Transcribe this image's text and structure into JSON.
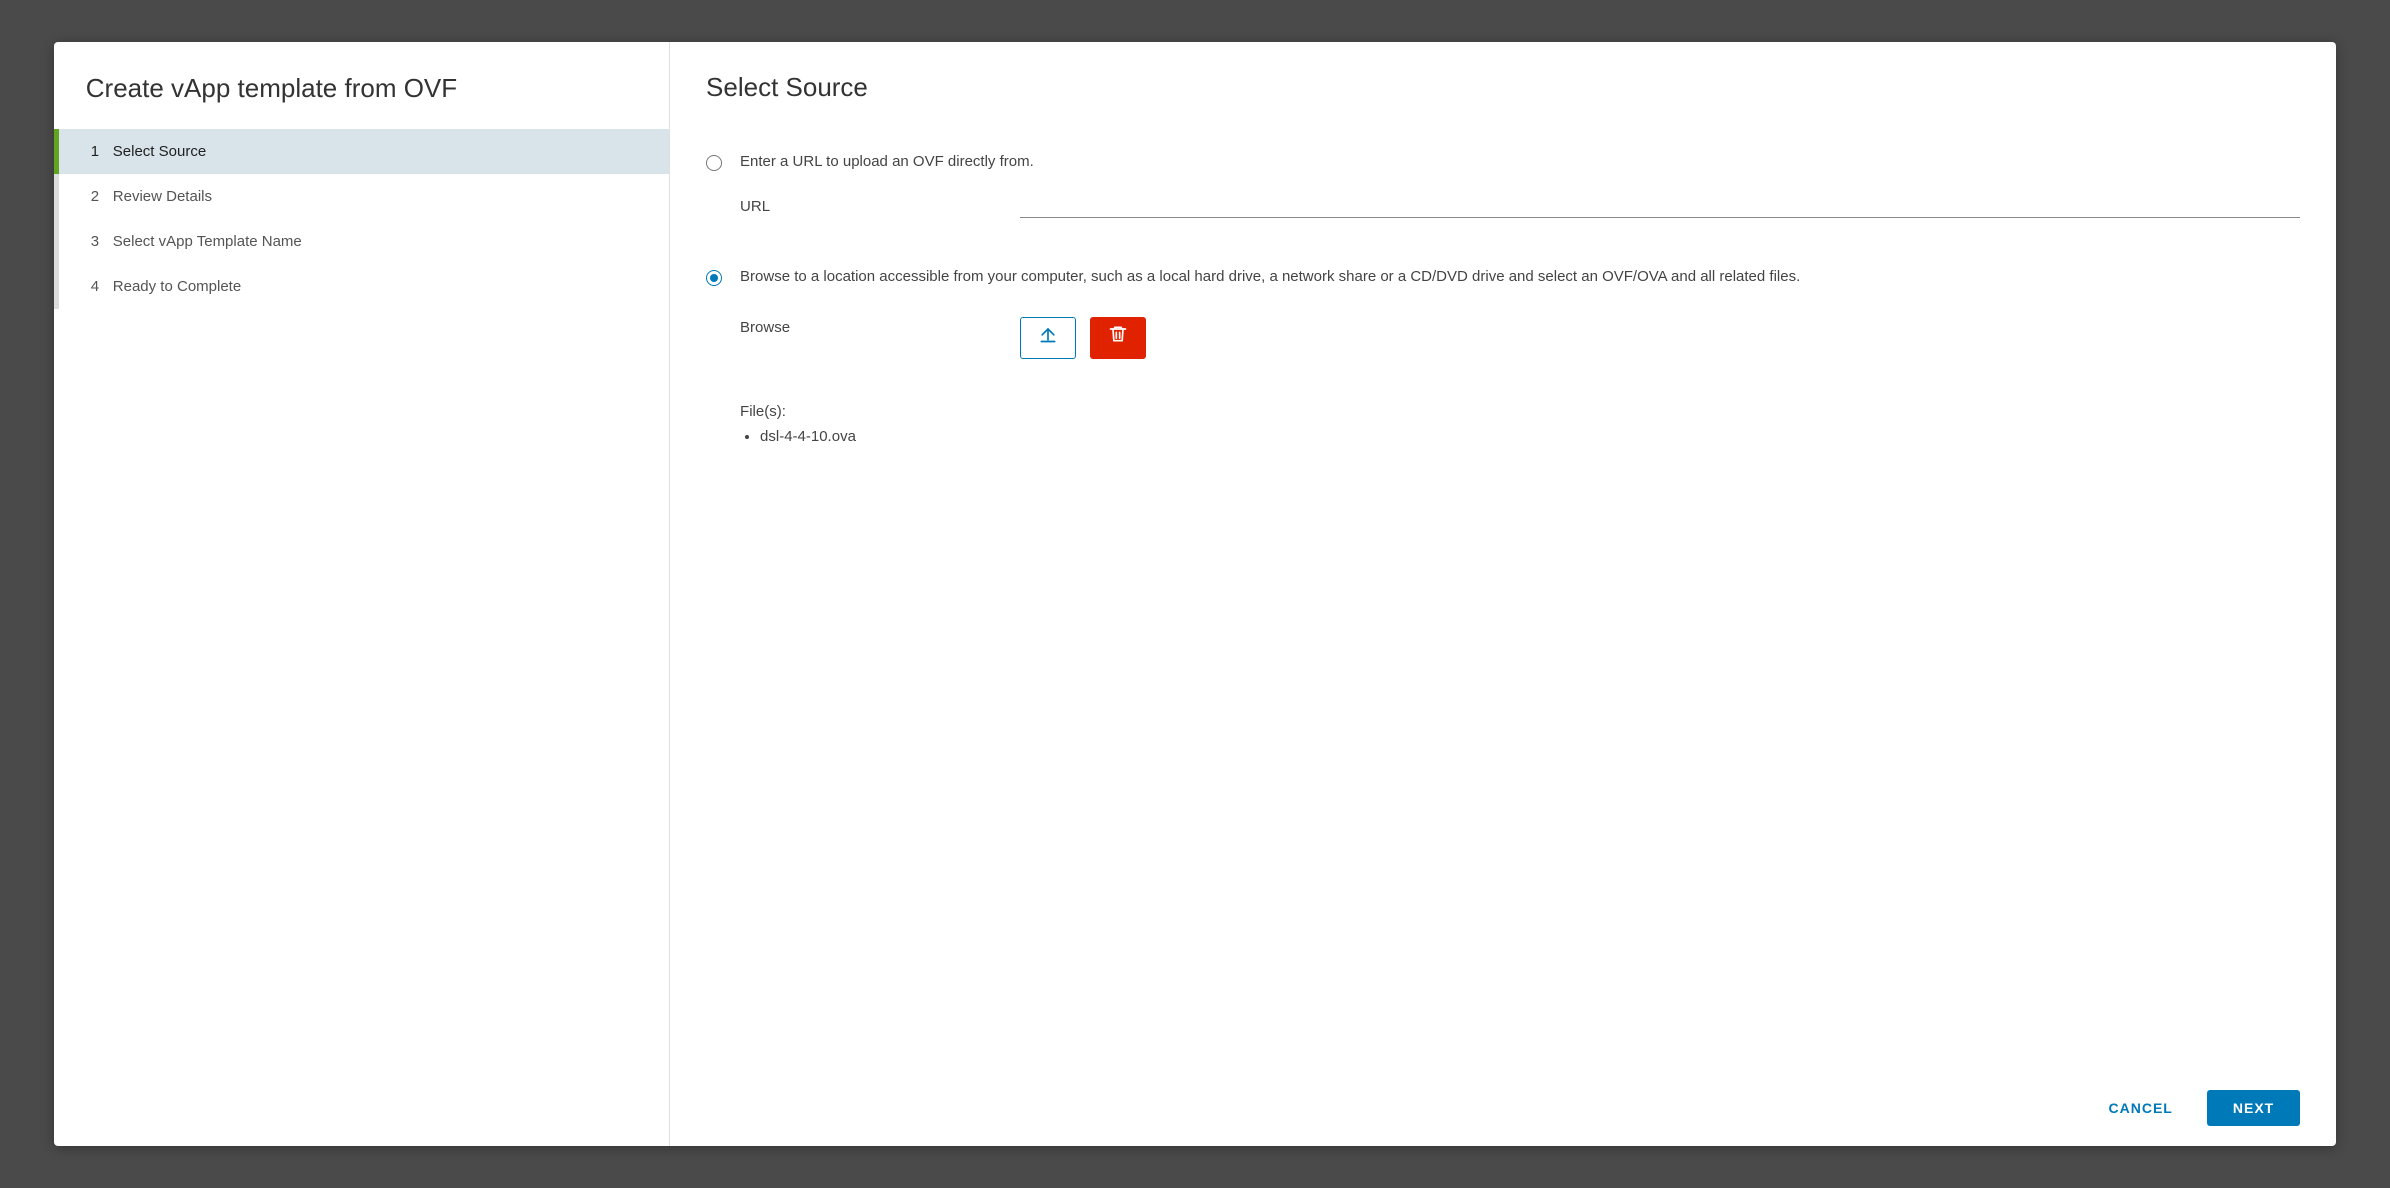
{
  "wizard": {
    "title": "Create vApp template from OVF",
    "steps": [
      {
        "num": "1",
        "label": "Select Source",
        "active": true
      },
      {
        "num": "2",
        "label": "Review Details",
        "active": false
      },
      {
        "num": "3",
        "label": "Select vApp Template Name",
        "active": false
      },
      {
        "num": "4",
        "label": "Ready to Complete",
        "active": false
      }
    ]
  },
  "page": {
    "heading": "Select Source",
    "url_option": {
      "description": "Enter a URL to upload an OVF directly from.",
      "label": "URL",
      "value": "",
      "selected": false
    },
    "browse_option": {
      "description": "Browse to a location accessible from your computer, such as a local hard drive, a network share or a CD/DVD drive and select an OVF/OVA and all related files.",
      "label": "Browse",
      "selected": true
    },
    "files_label": "File(s):",
    "files": [
      "dsl-4-4-10.ova"
    ]
  },
  "footer": {
    "cancel": "CANCEL",
    "next": "NEXT"
  },
  "icons": {
    "upload": "upload-icon",
    "delete": "trash-icon"
  }
}
